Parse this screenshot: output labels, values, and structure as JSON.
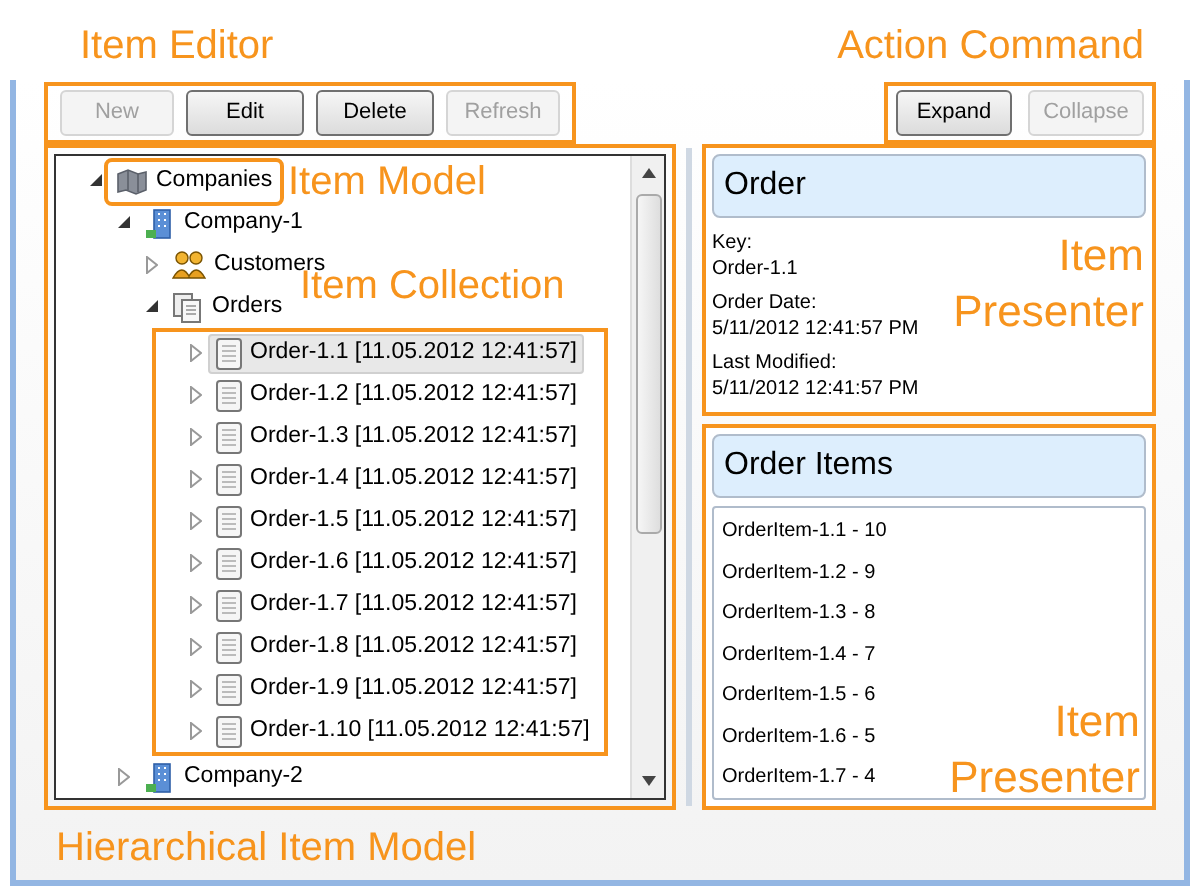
{
  "annotations": {
    "item_editor": "Item Editor",
    "action_command": "Action Command",
    "item_model": "Item Model",
    "item_collection": "Item Collection",
    "hierarchical_item_model": "Hierarchical Item Model",
    "presenter_top": "Item Presenter",
    "presenter_bottom": "Item Presenter"
  },
  "editor_buttons": [
    {
      "label": "New",
      "disabled": true
    },
    {
      "label": "Edit",
      "disabled": false
    },
    {
      "label": "Delete",
      "disabled": false
    },
    {
      "label": "Refresh",
      "disabled": true
    }
  ],
  "command_buttons": [
    {
      "label": "Expand",
      "disabled": false
    },
    {
      "label": "Collapse",
      "disabled": true
    }
  ],
  "tree": [
    {
      "label": "Companies",
      "kind": "root",
      "expanded": true,
      "selected": false,
      "children": [
        {
          "label": "Company-1",
          "kind": "company",
          "expanded": true,
          "selected": false,
          "children": [
            {
              "label": "Customers",
              "kind": "customers",
              "expanded": false,
              "selected": false
            },
            {
              "label": "Orders",
              "kind": "orders",
              "expanded": true,
              "selected": false,
              "children": [
                {
                  "label": "Order-1.1 [11.05.2012 12:41:57]",
                  "kind": "order",
                  "expanded": false,
                  "selected": true
                },
                {
                  "label": "Order-1.2 [11.05.2012 12:41:57]",
                  "kind": "order",
                  "expanded": false,
                  "selected": false
                },
                {
                  "label": "Order-1.3 [11.05.2012 12:41:57]",
                  "kind": "order",
                  "expanded": false,
                  "selected": false
                },
                {
                  "label": "Order-1.4 [11.05.2012 12:41:57]",
                  "kind": "order",
                  "expanded": false,
                  "selected": false
                },
                {
                  "label": "Order-1.5 [11.05.2012 12:41:57]",
                  "kind": "order",
                  "expanded": false,
                  "selected": false
                },
                {
                  "label": "Order-1.6 [11.05.2012 12:41:57]",
                  "kind": "order",
                  "expanded": false,
                  "selected": false
                },
                {
                  "label": "Order-1.7 [11.05.2012 12:41:57]",
                  "kind": "order",
                  "expanded": false,
                  "selected": false
                },
                {
                  "label": "Order-1.8 [11.05.2012 12:41:57]",
                  "kind": "order",
                  "expanded": false,
                  "selected": false
                },
                {
                  "label": "Order-1.9 [11.05.2012 12:41:57]",
                  "kind": "order",
                  "expanded": false,
                  "selected": false
                },
                {
                  "label": "Order-1.10 [11.05.2012 12:41:57]",
                  "kind": "order",
                  "expanded": false,
                  "selected": false
                }
              ]
            }
          ]
        },
        {
          "label": "Company-2",
          "kind": "company",
          "expanded": false,
          "selected": false
        }
      ]
    }
  ],
  "order_presenter": {
    "title": "Order",
    "fields": [
      {
        "label": "Key:",
        "value": "Order-1.1"
      },
      {
        "label": "Order Date:",
        "value": "5/11/2012 12:41:57 PM"
      },
      {
        "label": "Last Modified:",
        "value": "5/11/2012 12:41:57 PM"
      }
    ]
  },
  "items_presenter": {
    "title": "Order Items",
    "items": [
      "OrderItem-1.1 - 10",
      "OrderItem-1.2 - 9",
      "OrderItem-1.3 - 8",
      "OrderItem-1.4 - 7",
      "OrderItem-1.5 - 6",
      "OrderItem-1.6 - 5",
      "OrderItem-1.7 - 4"
    ]
  }
}
